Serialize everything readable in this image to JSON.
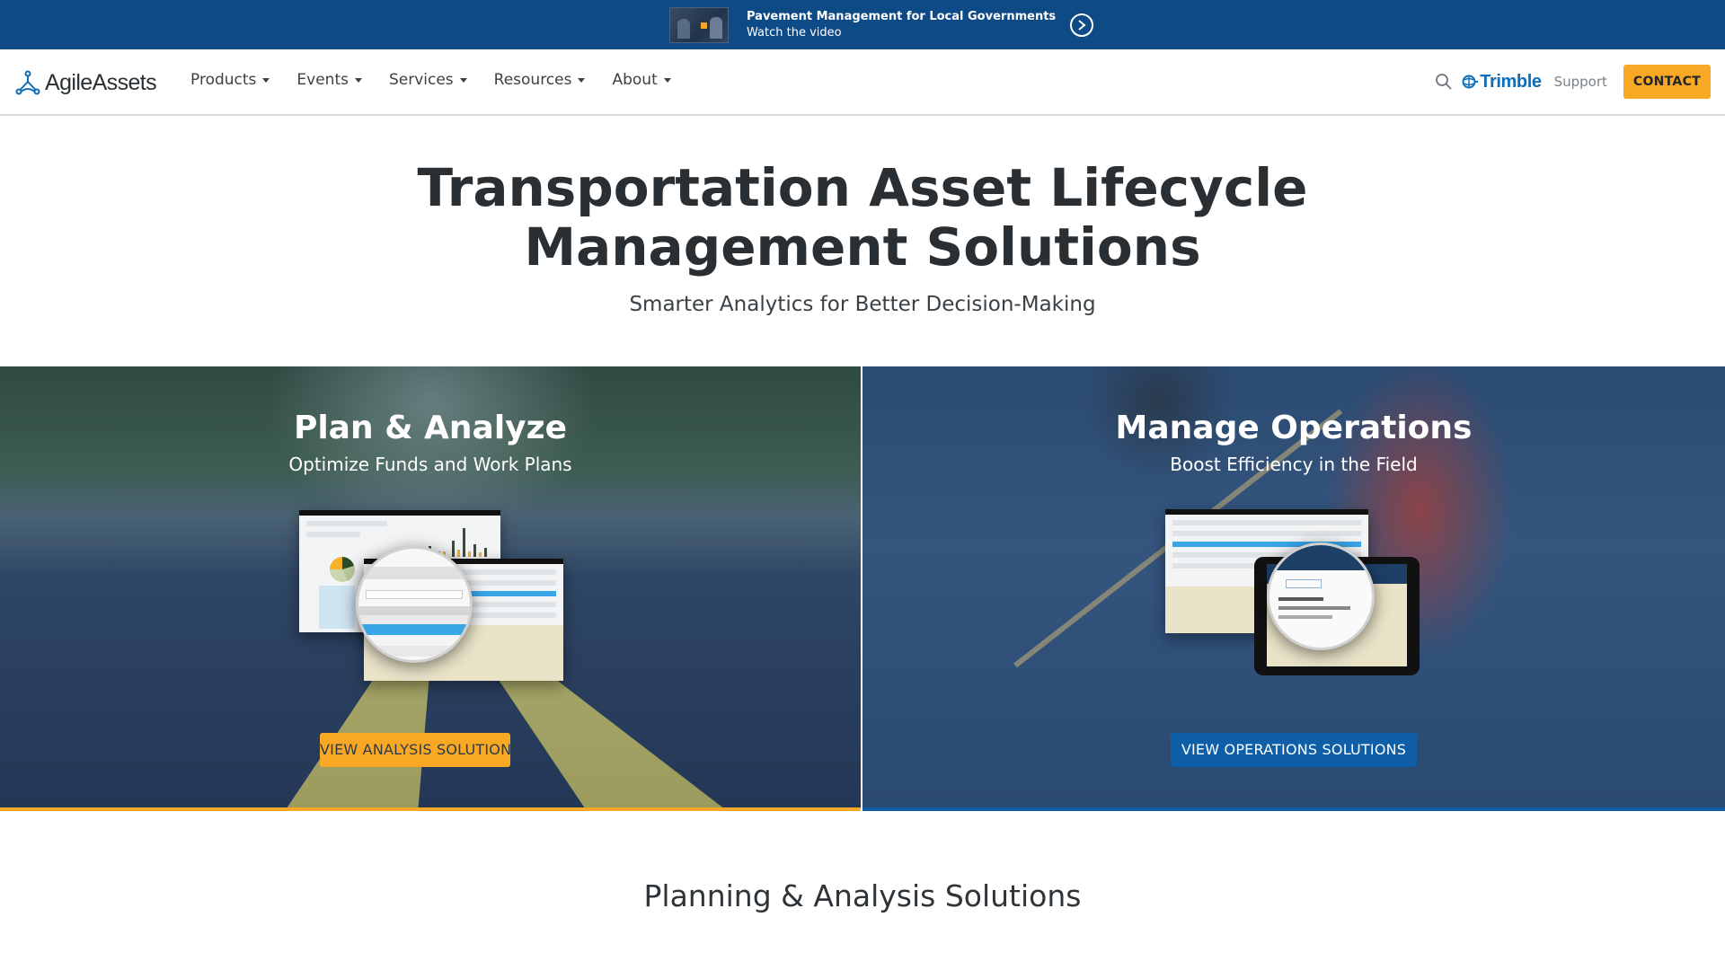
{
  "promo_banner": {
    "title": "Pavement Management for Local Governments",
    "subtitle": "Watch the video",
    "icon": "chevron-right-circle-icon",
    "background_color": "#0d4a86"
  },
  "nav": {
    "logo_text": "AgileAssets",
    "items": [
      {
        "label": "Products",
        "has_dropdown": true
      },
      {
        "label": "Events",
        "has_dropdown": true
      },
      {
        "label": "Services",
        "has_dropdown": true
      },
      {
        "label": "Resources",
        "has_dropdown": true
      },
      {
        "label": "About",
        "has_dropdown": true
      }
    ],
    "search_icon": "search-icon",
    "partner_logo_text": "Trimble",
    "support_label": "Support",
    "contact_label": "CONTACT",
    "accent_color": "#f8a825"
  },
  "hero": {
    "title_line1": "Transportation Asset Lifecycle",
    "title_line2": "Management Solutions",
    "subtitle": "Smarter Analytics for Better Decision-Making"
  },
  "panels": [
    {
      "title": "Plan & Analyze",
      "subtitle": "Optimize Funds and Work Plans",
      "button_label": "VIEW ANALYSIS SOLUTIONS",
      "button_color": "#f8a825",
      "accent_color": "#f8a825"
    },
    {
      "title": "Manage Operations",
      "subtitle": "Boost Efficiency in the Field",
      "button_label": "VIEW OPERATIONS SOLUTIONS",
      "button_color": "#0e5ea8",
      "accent_color": "#0e5ea8"
    }
  ],
  "section": {
    "heading": "Planning & Analysis Solutions"
  }
}
